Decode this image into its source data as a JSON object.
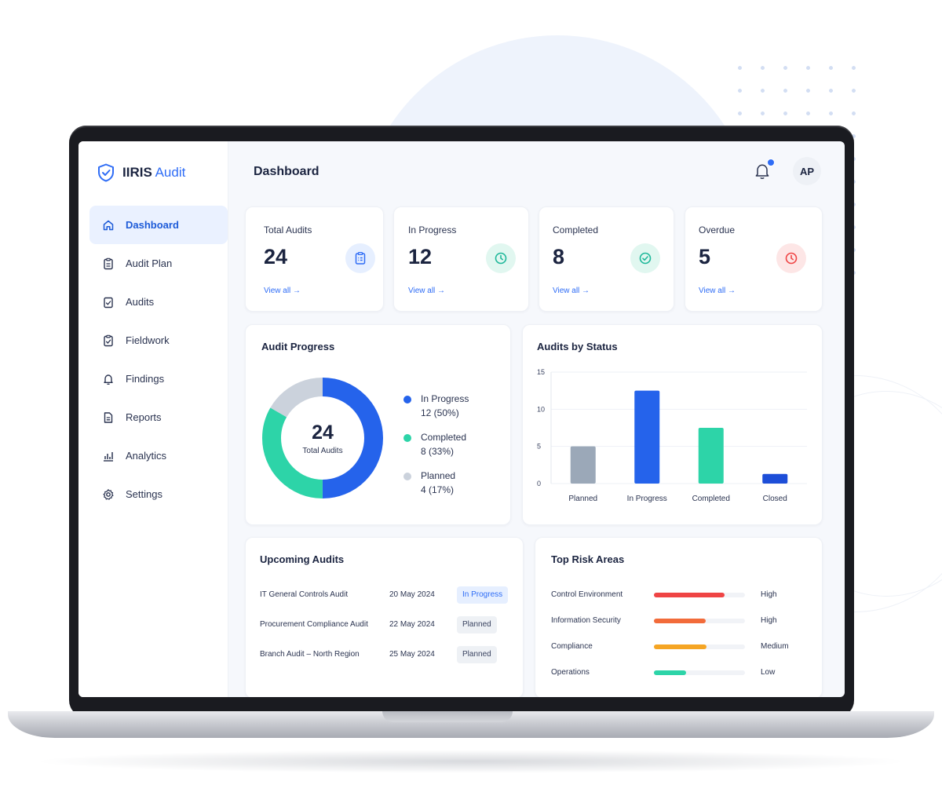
{
  "brand": {
    "name_bold": "IIRIS",
    "name_light": "Audit"
  },
  "sidebar": {
    "items": [
      {
        "label": "Dashboard",
        "icon": "home-icon",
        "active": true
      },
      {
        "label": "Audit Plan",
        "icon": "clipboard-icon"
      },
      {
        "label": "Audits",
        "icon": "checklist-icon"
      },
      {
        "label": "Fieldwork",
        "icon": "checklist-icon"
      },
      {
        "label": "Findings",
        "icon": "bell-icon"
      },
      {
        "label": "Reports",
        "icon": "document-icon"
      },
      {
        "label": "Analytics",
        "icon": "bar-chart-icon"
      },
      {
        "label": "Settings",
        "icon": "gear-icon"
      }
    ]
  },
  "header": {
    "title": "Dashboard",
    "avatar_initials": "AP",
    "has_notification": true
  },
  "kpis": [
    {
      "label": "Total Audits",
      "value": "24",
      "link": "View all →",
      "icon": "clipboard-icon",
      "color": "#2f6df6",
      "bg": "#e6efff"
    },
    {
      "label": "In Progress",
      "value": "12",
      "link": "View all →",
      "icon": "clock-icon",
      "color": "#1fb89a",
      "bg": "#e1f7f0"
    },
    {
      "label": "Completed",
      "value": "8",
      "link": "View all →",
      "icon": "check-circle-icon",
      "color": "#1fb89a",
      "bg": "#e1f7f0"
    },
    {
      "label": "Overdue",
      "value": "5",
      "link": "View all →",
      "icon": "clock-icon",
      "color": "#ef4444",
      "bg": "#fde6e6"
    }
  ],
  "audit_progress": {
    "title": "Audit Progress",
    "center_value": "24",
    "center_label": "Total Audits",
    "legend": [
      {
        "name": "In Progress",
        "value_text": "12 (50%)",
        "color": "#2563eb"
      },
      {
        "name": "Completed",
        "value_text": "8 (33%)",
        "color": "#2dd4a8"
      },
      {
        "name": "Planned",
        "value_text": "4 (17%)",
        "color": "#cbd2dc"
      }
    ]
  },
  "chart_data": [
    {
      "type": "pie",
      "title": "Audit Progress",
      "categories": [
        "In Progress",
        "Completed",
        "Planned"
      ],
      "values": [
        12,
        8,
        4
      ],
      "colors": [
        "#2563eb",
        "#2dd4a8",
        "#cbd2dc"
      ],
      "donut": true
    },
    {
      "type": "bar",
      "title": "Audits by Status",
      "categories": [
        "Planned",
        "In Progress",
        "Completed",
        "Closed"
      ],
      "values": [
        5,
        12.5,
        7.5,
        1.3
      ],
      "colors": [
        "#9ba8b8",
        "#2563eb",
        "#2dd4a8",
        "#1d4ed8"
      ],
      "ylim": [
        0,
        15
      ],
      "yticks": [
        "0",
        "5",
        "10",
        "15"
      ],
      "grid": true
    }
  ],
  "upcoming": {
    "title": "Upcoming Audits",
    "rows": [
      {
        "name": "IT General Controls Audit",
        "date": "20 May 2024",
        "status": "In Progress",
        "kind": "progress"
      },
      {
        "name": "Procurement Compliance Audit",
        "date": "22 May 2024",
        "status": "Planned",
        "kind": "planned"
      },
      {
        "name": "Branch Audit – North Region",
        "date": "25 May 2024",
        "status": "Planned",
        "kind": "planned"
      }
    ]
  },
  "risk": {
    "title": "Top Risk Areas",
    "rows": [
      {
        "name": "Control Environment",
        "level": "High",
        "fraction": 0.78,
        "color": "#ef4444"
      },
      {
        "name": "Information Security",
        "level": "High",
        "fraction": 0.57,
        "color": "#f26b3a"
      },
      {
        "name": "Compliance",
        "level": "Medium",
        "fraction": 0.58,
        "color": "#f5a524"
      },
      {
        "name": "Operations",
        "level": "Low",
        "fraction": 0.35,
        "color": "#2dd4a8"
      }
    ]
  }
}
